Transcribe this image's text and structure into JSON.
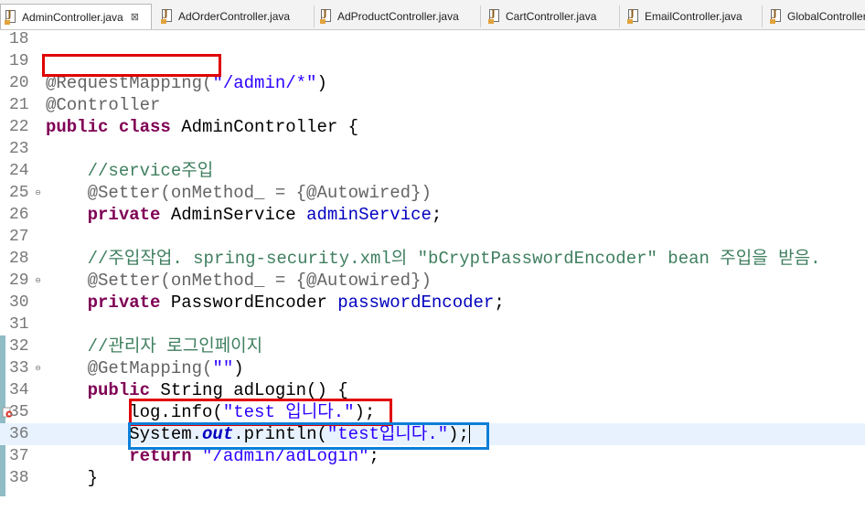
{
  "tabs": [
    {
      "label": "AdminController.java",
      "active": true,
      "close": "⊠"
    },
    {
      "label": "AdOrderController.java"
    },
    {
      "label": "AdProductController.java"
    },
    {
      "label": "CartController.java"
    },
    {
      "label": "EmailController.java"
    },
    {
      "label": "GlobalController"
    }
  ],
  "gutter": {
    "fold_icon": "⊖",
    "error_icon": "error-marker-icon"
  },
  "lines": [
    {
      "n": "18"
    },
    {
      "n": "19"
    },
    {
      "n": "20",
      "t": [
        "@RequestMapping(",
        "\"/admin/*\"",
        ")"
      ]
    },
    {
      "n": "21",
      "t": [
        "@Controller"
      ]
    },
    {
      "n": "22",
      "t": [
        "public class",
        " AdminController {"
      ]
    },
    {
      "n": "23"
    },
    {
      "n": "24",
      "t": [
        "    //service주입"
      ]
    },
    {
      "n": "25",
      "t": [
        "    @Setter(onMethod_ = {@Autowired})"
      ]
    },
    {
      "n": "26",
      "t": [
        "    ",
        "private",
        " AdminService ",
        "adminService",
        ";"
      ]
    },
    {
      "n": "27"
    },
    {
      "n": "28",
      "t": [
        "    //주입작업. spring-security.xml의 \"bCryptPasswordEncoder\" bean 주입을 받음."
      ]
    },
    {
      "n": "29",
      "t": [
        "    @Setter(onMethod_ = {@Autowired})"
      ]
    },
    {
      "n": "30",
      "t": [
        "    ",
        "private",
        " PasswordEncoder ",
        "passwordEncoder",
        ";"
      ]
    },
    {
      "n": "31"
    },
    {
      "n": "32",
      "t": [
        "    //관리자 로그인페이지"
      ]
    },
    {
      "n": "33",
      "t": [
        "    @GetMapping(",
        "\"\"",
        ")"
      ]
    },
    {
      "n": "34",
      "t": [
        "    ",
        "public",
        " String adLogin() {"
      ]
    },
    {
      "n": "35",
      "t": [
        "        log.info(",
        "\"test 입니다.\"",
        ");"
      ]
    },
    {
      "n": "36",
      "t": [
        "        System.",
        "out",
        ".println(",
        "\"test입니다.\"",
        ");"
      ]
    },
    {
      "n": "37",
      "t": [
        "        ",
        "return",
        " ",
        "\"/admin/adLogin\"",
        ";"
      ]
    },
    {
      "n": "38",
      "t": [
        "    }"
      ]
    }
  ]
}
